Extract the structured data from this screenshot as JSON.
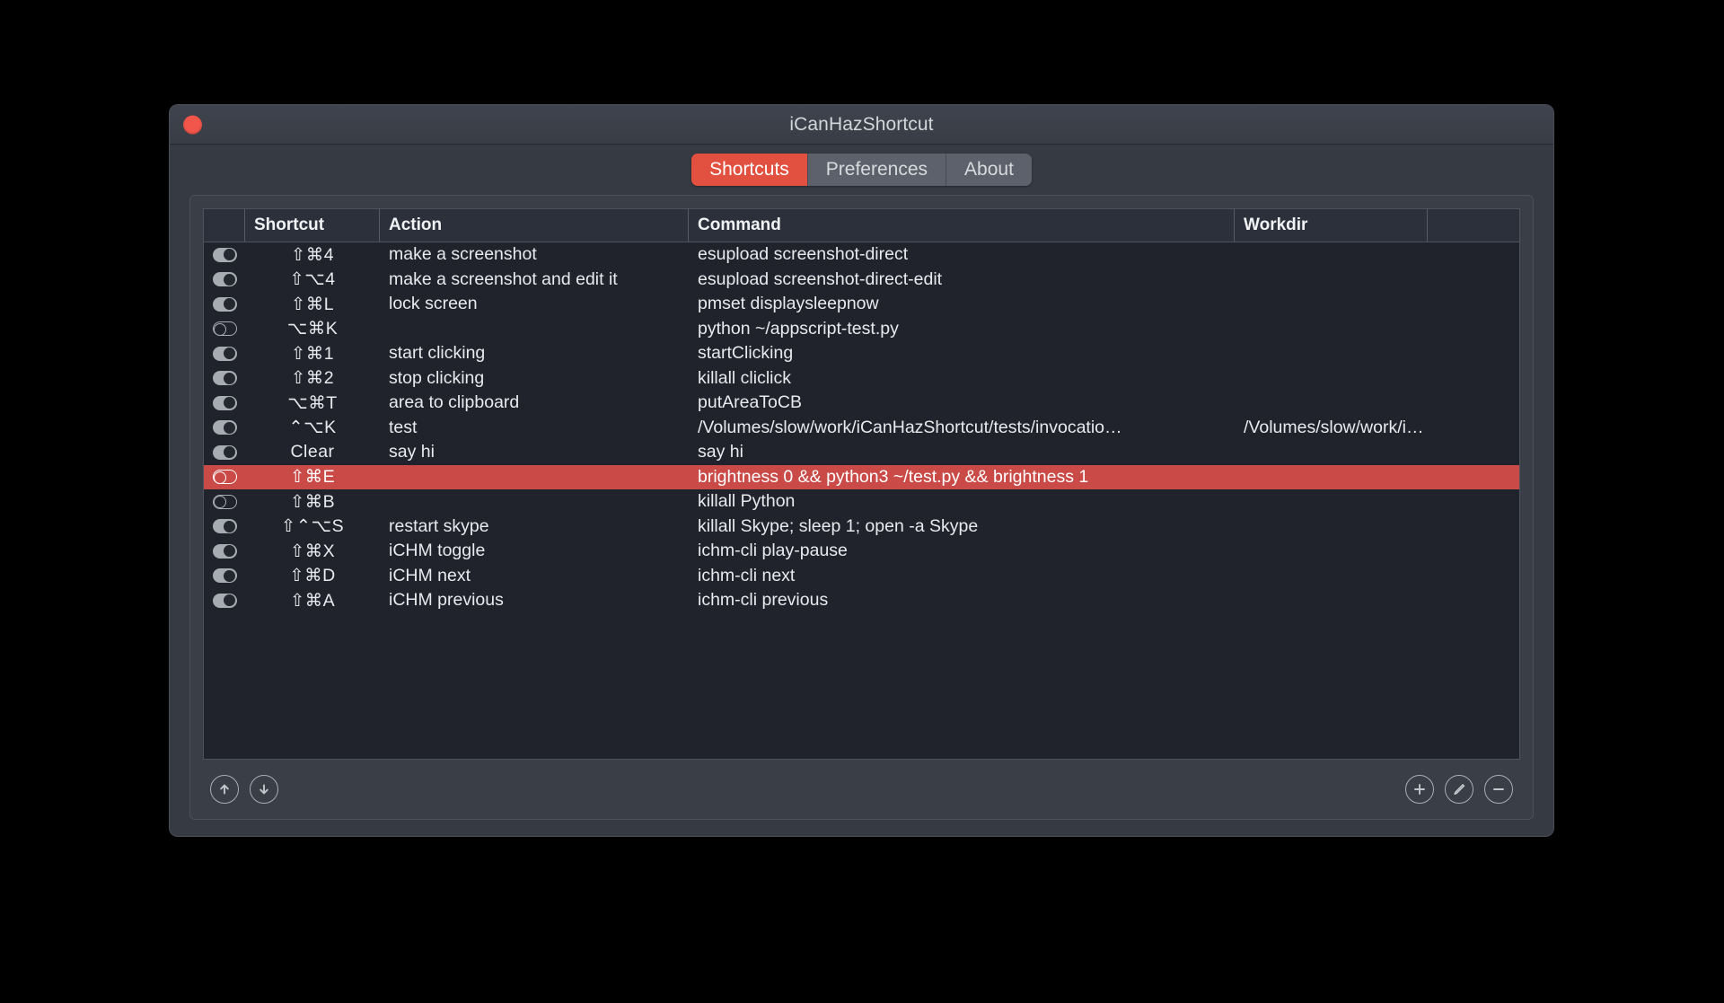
{
  "window": {
    "title": "iCanHazShortcut",
    "close_label": "close"
  },
  "tabs": [
    {
      "label": "Shortcuts",
      "active": true
    },
    {
      "label": "Preferences",
      "active": false
    },
    {
      "label": "About",
      "active": false
    }
  ],
  "table": {
    "columns": [
      "",
      "Shortcut",
      "Action",
      "Command",
      "Workdir",
      ""
    ],
    "rows": [
      {
        "enabled": true,
        "shortcut": "⇧⌘4",
        "action": "make a screenshot",
        "command": "esupload screenshot-direct",
        "workdir": "",
        "selected": false
      },
      {
        "enabled": true,
        "shortcut": "⇧⌥4",
        "action": "make a screenshot and edit it",
        "command": "esupload screenshot-direct-edit",
        "workdir": "",
        "selected": false
      },
      {
        "enabled": true,
        "shortcut": "⇧⌘L",
        "action": "lock screen",
        "command": "pmset displaysleepnow",
        "workdir": "",
        "selected": false
      },
      {
        "enabled": false,
        "shortcut": "⌥⌘K",
        "action": "",
        "command": "python ~/appscript-test.py",
        "workdir": "",
        "selected": false
      },
      {
        "enabled": true,
        "shortcut": "⇧⌘1",
        "action": "start clicking",
        "command": "startClicking",
        "workdir": "",
        "selected": false
      },
      {
        "enabled": true,
        "shortcut": "⇧⌘2",
        "action": "stop clicking",
        "command": "killall cliclick",
        "workdir": "",
        "selected": false
      },
      {
        "enabled": true,
        "shortcut": "⌥⌘T",
        "action": "area to clipboard",
        "command": "putAreaToCB",
        "workdir": "",
        "selected": false
      },
      {
        "enabled": true,
        "shortcut": "⌃⌥K",
        "action": "test",
        "command": "/Volumes/slow/work/iCanHazShortcut/tests/invocatio…",
        "workdir": "/Volumes/slow/work/i…",
        "selected": false
      },
      {
        "enabled": true,
        "shortcut": "Clear",
        "action": "say hi",
        "command": "say hi",
        "workdir": "",
        "selected": false
      },
      {
        "enabled": false,
        "shortcut": "⇧⌘E",
        "action": "",
        "command": "brightness 0 && python3 ~/test.py && brightness 1",
        "workdir": "",
        "selected": true
      },
      {
        "enabled": false,
        "shortcut": "⇧⌘B",
        "action": "",
        "command": "killall Python",
        "workdir": "",
        "selected": false
      },
      {
        "enabled": true,
        "shortcut": "⇧⌃⌥S",
        "action": "restart skype",
        "command": "killall Skype; sleep 1; open -a Skype",
        "workdir": "",
        "selected": false
      },
      {
        "enabled": true,
        "shortcut": "⇧⌘X",
        "action": "iCHM toggle",
        "command": "ichm-cli play-pause",
        "workdir": "",
        "selected": false
      },
      {
        "enabled": true,
        "shortcut": "⇧⌘D",
        "action": "iCHM next",
        "command": "ichm-cli next",
        "workdir": "",
        "selected": false
      },
      {
        "enabled": true,
        "shortcut": "⇧⌘A",
        "action": "iCHM previous",
        "command": "ichm-cli previous",
        "workdir": "",
        "selected": false
      }
    ]
  },
  "toolbar": {
    "move_up_label": "move up",
    "move_down_label": "move down",
    "add_label": "add",
    "edit_label": "edit",
    "remove_label": "remove"
  },
  "colors": {
    "accent": "#e2503f",
    "selection": "#c94a47",
    "titlebar": "#3f434d",
    "panel": "#3a3e47",
    "table_bg": "#20232c",
    "close_button": "#f2564b"
  }
}
